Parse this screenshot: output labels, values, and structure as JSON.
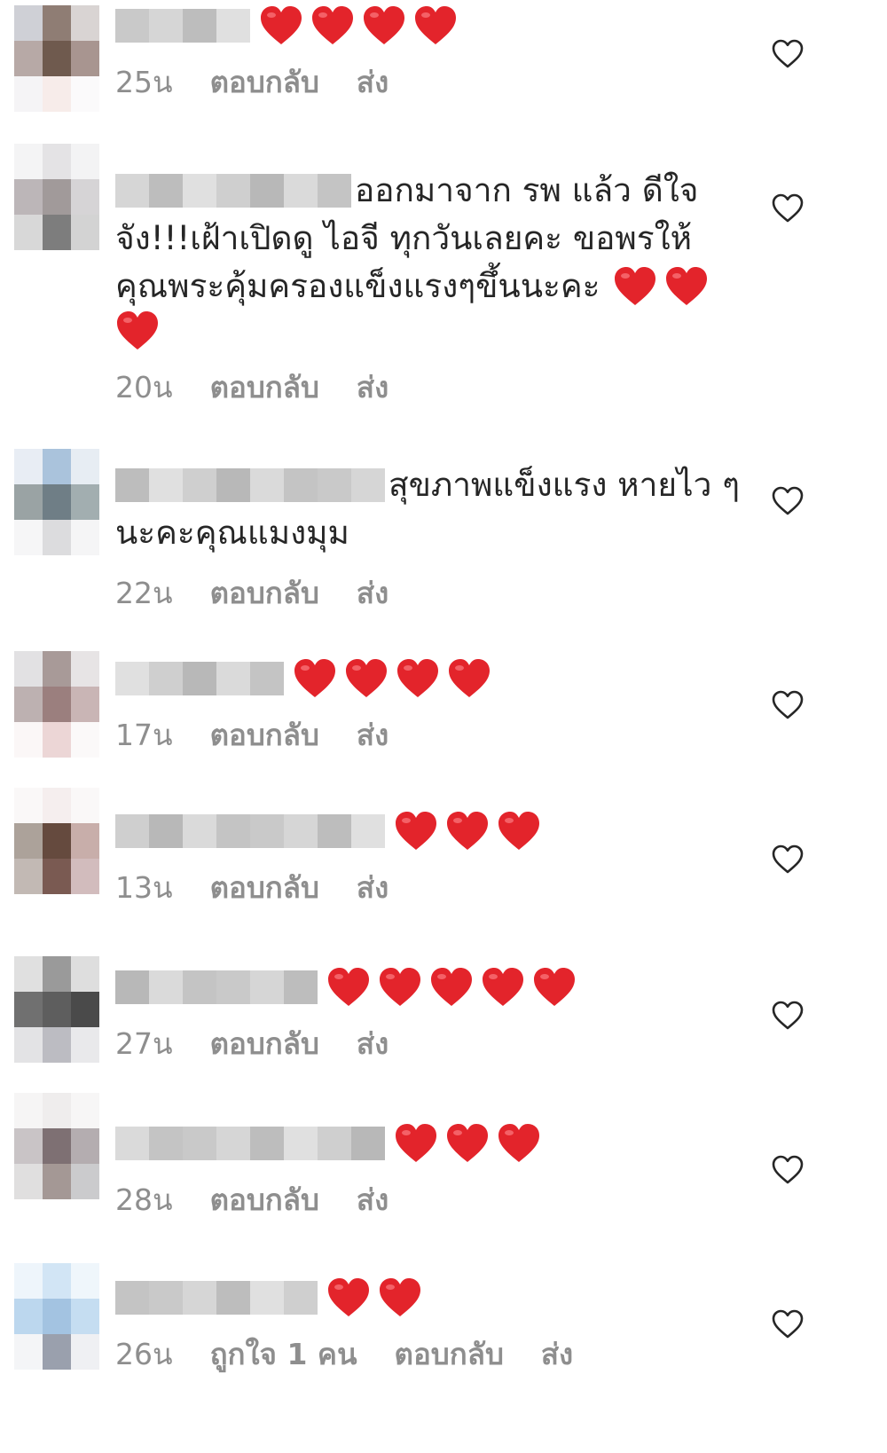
{
  "colors": {
    "heart": "#e3242b",
    "meta": "#8e8e8e",
    "text": "#262626"
  },
  "labels": {
    "reply": "ตอบกลับ",
    "send": "ส่ง"
  },
  "comments": [
    {
      "username": "aray200",
      "lines": [],
      "heart_count": 4,
      "time": "25น",
      "likes_text": "",
      "avatar": [
        "#cfd0d6",
        "#8f7d74",
        "#d9d4d3",
        "#b7a9a6",
        "#6f5a4e",
        "#a89590",
        "#f5f4f6",
        "#f7ecea",
        "#fbfafb"
      ]
    },
    {
      "username": "",
      "lines": [
        "ออกมาจาก รพ แล้ว ดีใจ",
        "จัง!!!เฝ้าเปิดดู ไอจี ทุกวันเลยคะ ขอพรให้",
        "คุณพระคุ้มครองแข็งแรงๆขึ้นนะคะ"
      ],
      "heart_count": 3,
      "time": "20น",
      "likes_text": "",
      "avatar": [
        "#f4f4f5",
        "#e4e3e5",
        "#f3f3f4",
        "#bcb6b8",
        "#a19a9a",
        "#d6d4d6",
        "#d8d8d8",
        "#7d7d7d",
        "#d3d3d3"
      ]
    },
    {
      "username": "",
      "lines": [
        "สุขภาพแข็งแรง หายไว ๆ",
        "นะคะคุณแมงมุม"
      ],
      "heart_count": 0,
      "time": "22น",
      "likes_text": "",
      "avatar": [
        "#e8edf4",
        "#aac3dc",
        "#e7edf3",
        "#9aa3a4",
        "#6f7e86",
        "#a2aeb0",
        "#f6f6f7",
        "#dcdcde",
        "#f5f5f6"
      ]
    },
    {
      "username": "",
      "lines": [],
      "heart_count": 4,
      "time": "17น",
      "likes_text": "",
      "avatar": [
        "#e2e1e3",
        "#a89a98",
        "#e7e4e5",
        "#bdb1b1",
        "#9b7f7e",
        "#c9b5b5",
        "#fbf7f7",
        "#ecd6d6",
        "#fbf9f9"
      ]
    },
    {
      "username": "",
      "lines": [],
      "heart_count": 3,
      "time": "13น",
      "likes_text": "",
      "avatar": [
        "#faf8f8",
        "#f5eeee",
        "#faf8f8",
        "#aca29a",
        "#654a3e",
        "#c8aeaa",
        "#c2b9b4",
        "#7a5a52",
        "#d2bcbd"
      ]
    },
    {
      "username": "",
      "lines": [],
      "heart_count": 5,
      "time": "27น",
      "likes_text": "",
      "avatar": [
        "#e0e0e0",
        "#9a9a9a",
        "#dedede",
        "#707070",
        "#5e5e5e",
        "#4a4a4a",
        "#e3e3e5",
        "#bcbcc2",
        "#e9e9eb"
      ]
    },
    {
      "username": "",
      "lines": [],
      "heart_count": 3,
      "time": "28น",
      "likes_text": "",
      "avatar": [
        "#f6f5f5",
        "#efeded",
        "#f7f6f6",
        "#c9c4c6",
        "#7e7073",
        "#b4adb0",
        "#e0dfdf",
        "#a49895",
        "#cbcbcd"
      ]
    },
    {
      "username": "",
      "lines": [],
      "heart_count": 2,
      "time": "26น",
      "likes_text": "ถูกใจ 1 คน",
      "avatar": [
        "#eef5fb",
        "#d2e5f5",
        "#eff6fb",
        "#bcd7ee",
        "#a3c3e1",
        "#c5ddf1",
        "#f4f5f7",
        "#9aa0ad",
        "#eff0f3"
      ]
    }
  ]
}
